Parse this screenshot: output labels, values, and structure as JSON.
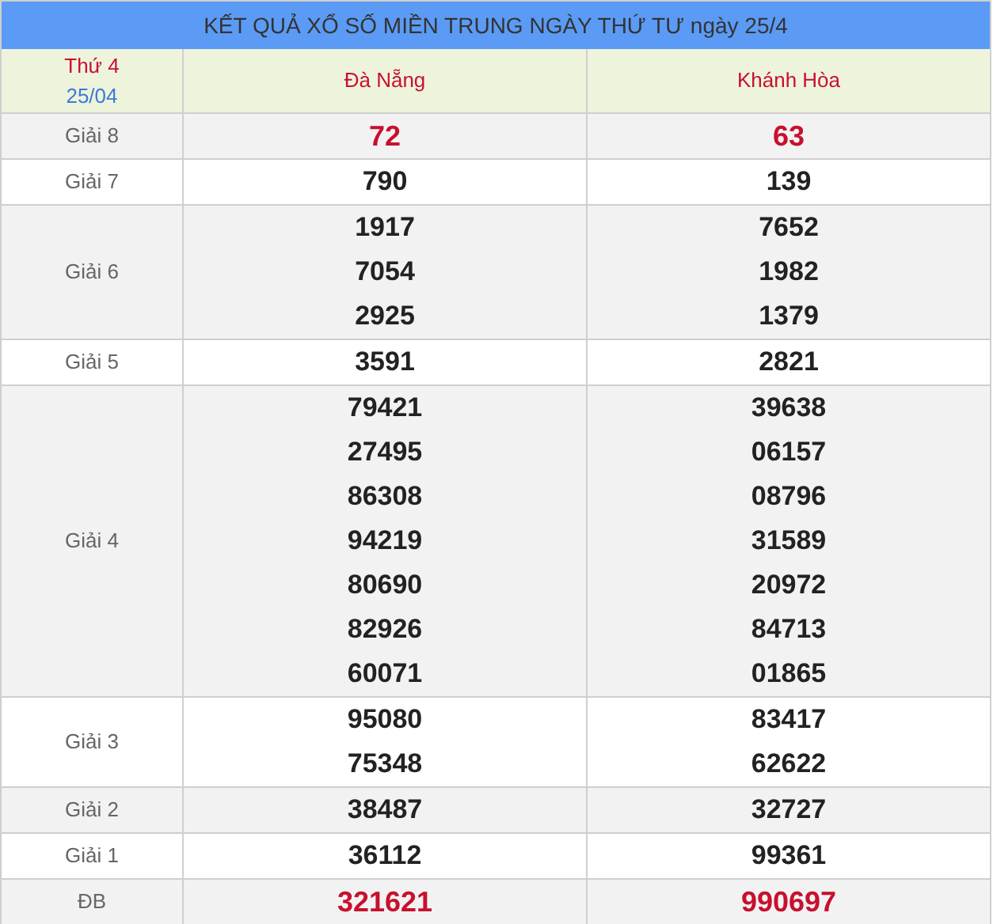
{
  "title": "KẾT QUẢ XỔ SỐ MIỀN TRUNG NGÀY THỨ TƯ ngày 25/4",
  "header": {
    "weekday": "Thứ 4",
    "date": "25/04",
    "provinces": [
      "Đà Nẵng",
      "Khánh Hòa"
    ]
  },
  "rows": [
    {
      "prize": "Giải 8",
      "highlight": true,
      "results": [
        [
          "72"
        ],
        [
          "63"
        ]
      ]
    },
    {
      "prize": "Giải 7",
      "highlight": false,
      "results": [
        [
          "790"
        ],
        [
          "139"
        ]
      ]
    },
    {
      "prize": "Giải 6",
      "highlight": false,
      "results": [
        [
          "1917",
          "7054",
          "2925"
        ],
        [
          "7652",
          "1982",
          "1379"
        ]
      ]
    },
    {
      "prize": "Giải 5",
      "highlight": false,
      "results": [
        [
          "3591"
        ],
        [
          "2821"
        ]
      ]
    },
    {
      "prize": "Giải 4",
      "highlight": false,
      "results": [
        [
          "79421",
          "27495",
          "86308",
          "94219",
          "80690",
          "82926",
          "60071"
        ],
        [
          "39638",
          "06157",
          "08796",
          "31589",
          "20972",
          "84713",
          "01865"
        ]
      ]
    },
    {
      "prize": "Giải 3",
      "highlight": false,
      "results": [
        [
          "95080",
          "75348"
        ],
        [
          "83417",
          "62622"
        ]
      ]
    },
    {
      "prize": "Giải 2",
      "highlight": false,
      "results": [
        [
          "38487"
        ],
        [
          "32727"
        ]
      ]
    },
    {
      "prize": "Giải 1",
      "highlight": false,
      "results": [
        [
          "36112"
        ],
        [
          "99361"
        ]
      ]
    },
    {
      "prize": "ĐB",
      "highlight": true,
      "results": [
        [
          "321621"
        ],
        [
          "990697"
        ]
      ]
    }
  ]
}
